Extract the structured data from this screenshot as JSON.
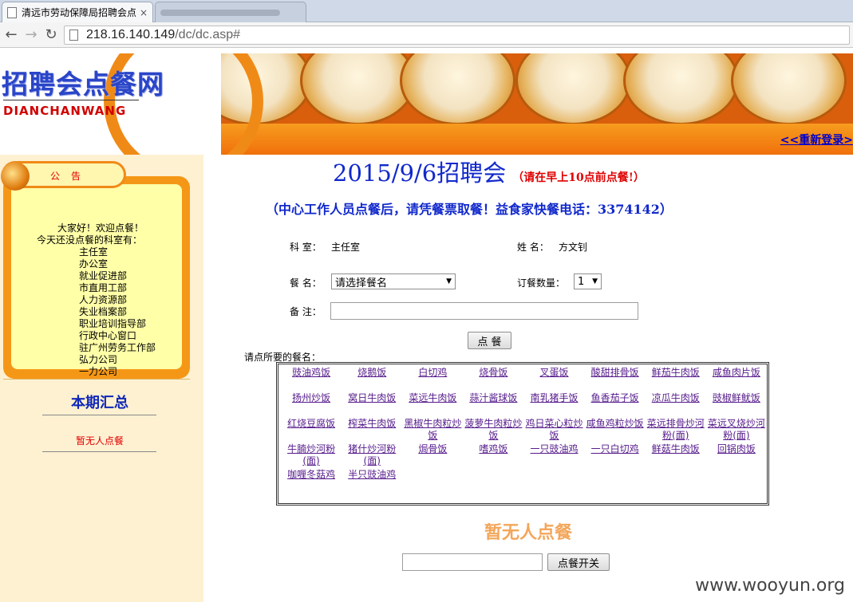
{
  "browser": {
    "tabs": [
      {
        "title": "清远市劳动保障局招聘会点",
        "close": "×"
      }
    ],
    "url_host": "218.16.140.149",
    "url_path": "/dc/dc.asp#"
  },
  "banner": {
    "site_title": "招聘会点餐网",
    "site_sub": "DIANCHANWANG",
    "relogin": "<<重新登录>"
  },
  "sidebar": {
    "notice_label": "公告",
    "greeting": "大家好！欢迎点餐！",
    "intro": "今天还没点餐的科室有：",
    "departments": [
      "主任室",
      "办公室",
      "就业促进部",
      "市直用工部",
      "人力资源部",
      "失业档案部",
      "职业培训指导部",
      "行政中心窗口",
      "驻广州劳务工作部",
      "弘力公司",
      "一力公司"
    ],
    "summary_title": "本期汇总",
    "summary_none": "暂无人点餐"
  },
  "main": {
    "title": "2015/9/6招聘会",
    "title_note": "（请在早上10点前点餐!）",
    "subtitle": "（中心工作人员点餐后，请凭餐票取餐！益食家快餐电话：3374142）",
    "dept_label": "科 室：",
    "dept_value": "主任室",
    "name_label": "姓 名：",
    "name_value": "方文钊",
    "meal_label": "餐 名：",
    "meal_select": "请选择餐名",
    "qty_label": "订餐数量：",
    "qty_value": "1",
    "remark_label": "备 注：",
    "order_button": "点 餐",
    "menu_prompt": "请点所要的餐名：",
    "menu": [
      [
        "豉油鸡饭",
        "烧鹅饭",
        "白切鸡",
        "烧骨饭",
        "叉蛋饭",
        "酸甜排骨饭",
        "鲜茄牛肉饭",
        "咸鱼肉片饭"
      ],
      [
        "扬州炒饭",
        "窝日牛肉饭",
        "菜远牛肉饭",
        "蒜汁酱球饭",
        "南乳猪手饭",
        "鱼香茄子饭",
        "凉瓜牛肉饭",
        "豉椒鲜鱿饭"
      ],
      [
        "红烧豆腐饭",
        "榨菜牛肉饭",
        "黑椒牛肉粒炒饭",
        "菠萝牛肉粒炒饭",
        "鸡日菜心粒炒饭",
        "咸鱼鸡粒炒饭",
        "菜远排骨炒河粉(面)",
        "菜远叉烧炒河粉(面)"
      ],
      [
        "牛腩炒河粉(面)",
        "猪什炒河粉(面)",
        "焗骨饭",
        "嗜鸡饭",
        "一只豉油鸡",
        "一只白切鸡",
        "鲜菇牛肉饭",
        "回锅肉饭"
      ],
      [
        "咖喱冬菇鸡",
        "半只豉油鸡",
        "",
        "",
        "",
        "",
        "",
        ""
      ]
    ],
    "no_order": "暂无人点餐",
    "toggle_button": "点餐开关"
  },
  "watermark": "www.wooyun.org"
}
